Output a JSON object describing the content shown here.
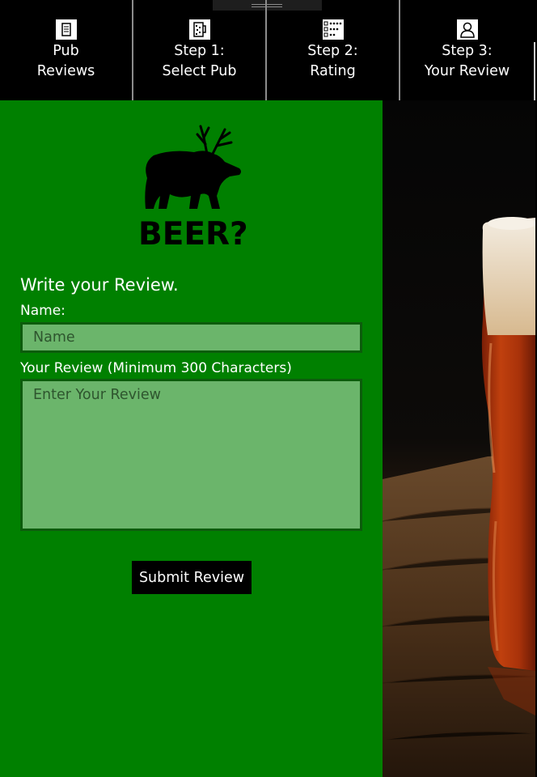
{
  "nav": {
    "tabs": [
      {
        "label": "Pub\nReviews",
        "icon": "reviews-doc-icon"
      },
      {
        "label": "Step 1:\nSelect Pub",
        "icon": "beer-mug-icon"
      },
      {
        "label": "Step 2:\nRating",
        "icon": "checklist-icon"
      },
      {
        "label": "Step 3:\nYour Review",
        "icon": "user-icon"
      }
    ]
  },
  "logo": {
    "text": "BEER?"
  },
  "form": {
    "title": "Write your Review.",
    "name_label": "Name:",
    "name_placeholder": "Name",
    "review_label": "Your Review (Minimum 300 Characters)",
    "review_placeholder": "Enter Your Review",
    "submit_label": "Submit Review"
  },
  "colors": {
    "panel": "#008000",
    "input_bg": "#6bb56b",
    "input_border": "#0c5c0c",
    "topbar": "#000000",
    "button": "#000000"
  }
}
